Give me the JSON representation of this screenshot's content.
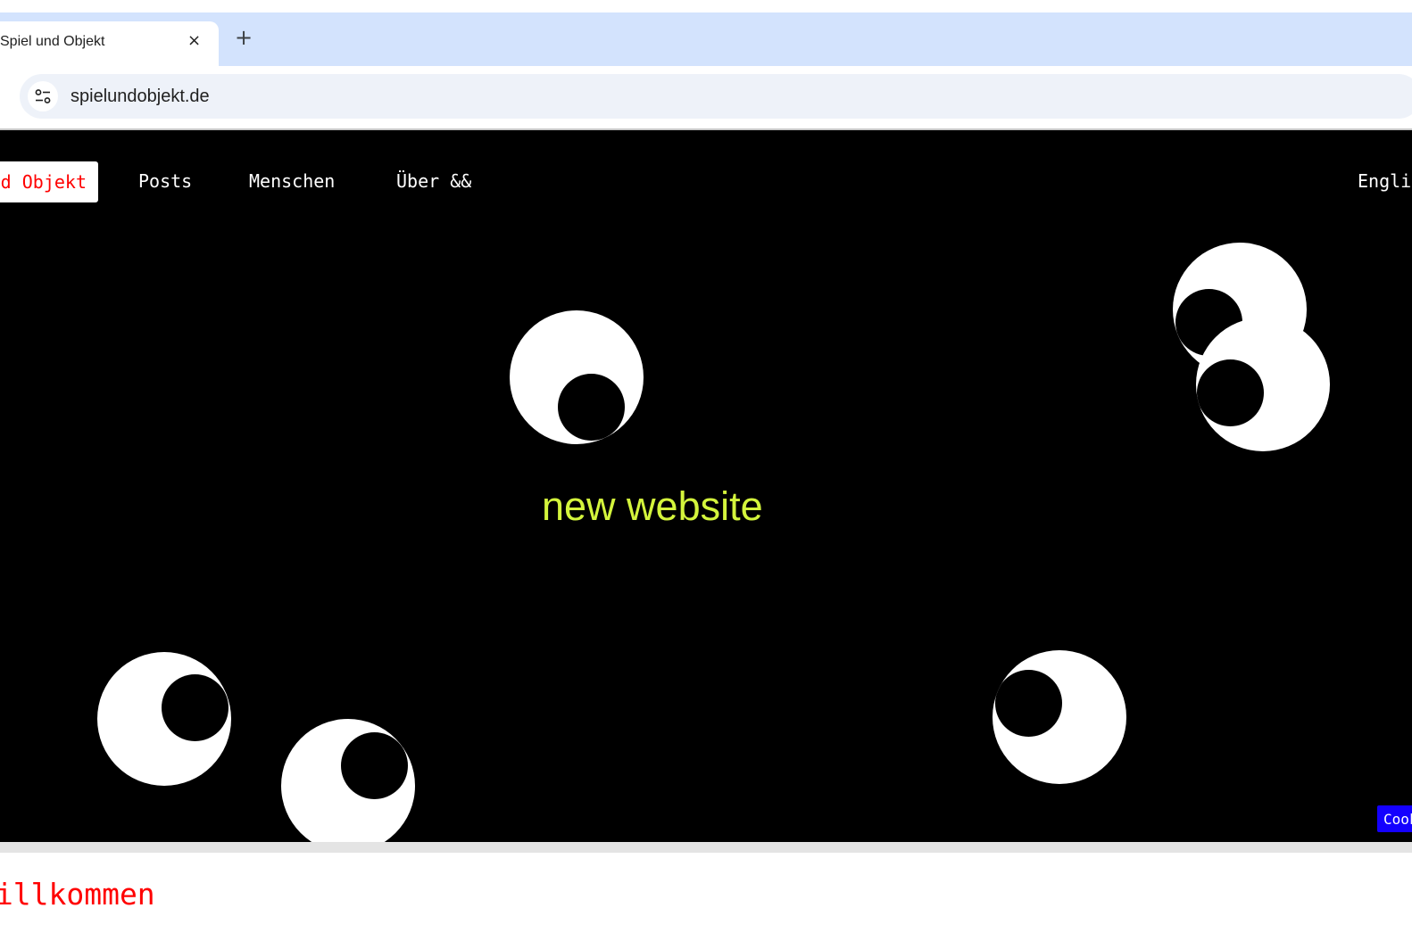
{
  "browser": {
    "tab_title": "Spiel und Objekt",
    "close_icon": "×",
    "new_tab_icon": "+",
    "url": "spielundobjekt.de"
  },
  "nav": {
    "brand": "Spiel und Objekt",
    "posts": "Posts",
    "menschen": "Menschen",
    "ueber": "Über &&",
    "language": "English"
  },
  "hero": {
    "text": "new website",
    "text_color": "#d4f53c",
    "background": "#000000",
    "decoration": "googly-eyes"
  },
  "cookie_button": {
    "label": "Cookies",
    "color": "#1400ff"
  },
  "main": {
    "heading": "Willkommen",
    "heading_color": "#ff0000"
  }
}
